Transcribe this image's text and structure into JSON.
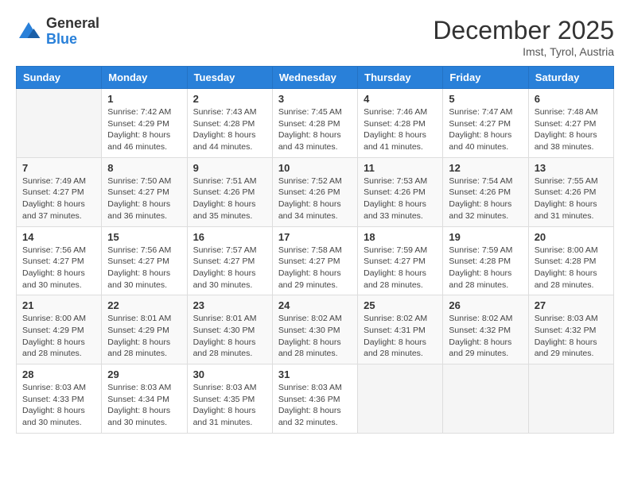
{
  "logo": {
    "general": "General",
    "blue": "Blue"
  },
  "header": {
    "month": "December 2025",
    "location": "Imst, Tyrol, Austria"
  },
  "weekdays": [
    "Sunday",
    "Monday",
    "Tuesday",
    "Wednesday",
    "Thursday",
    "Friday",
    "Saturday"
  ],
  "weeks": [
    [
      {
        "day": "",
        "info": ""
      },
      {
        "day": "1",
        "info": "Sunrise: 7:42 AM\nSunset: 4:29 PM\nDaylight: 8 hours\nand 46 minutes."
      },
      {
        "day": "2",
        "info": "Sunrise: 7:43 AM\nSunset: 4:28 PM\nDaylight: 8 hours\nand 44 minutes."
      },
      {
        "day": "3",
        "info": "Sunrise: 7:45 AM\nSunset: 4:28 PM\nDaylight: 8 hours\nand 43 minutes."
      },
      {
        "day": "4",
        "info": "Sunrise: 7:46 AM\nSunset: 4:28 PM\nDaylight: 8 hours\nand 41 minutes."
      },
      {
        "day": "5",
        "info": "Sunrise: 7:47 AM\nSunset: 4:27 PM\nDaylight: 8 hours\nand 40 minutes."
      },
      {
        "day": "6",
        "info": "Sunrise: 7:48 AM\nSunset: 4:27 PM\nDaylight: 8 hours\nand 38 minutes."
      }
    ],
    [
      {
        "day": "7",
        "info": "Sunrise: 7:49 AM\nSunset: 4:27 PM\nDaylight: 8 hours\nand 37 minutes."
      },
      {
        "day": "8",
        "info": "Sunrise: 7:50 AM\nSunset: 4:27 PM\nDaylight: 8 hours\nand 36 minutes."
      },
      {
        "day": "9",
        "info": "Sunrise: 7:51 AM\nSunset: 4:26 PM\nDaylight: 8 hours\nand 35 minutes."
      },
      {
        "day": "10",
        "info": "Sunrise: 7:52 AM\nSunset: 4:26 PM\nDaylight: 8 hours\nand 34 minutes."
      },
      {
        "day": "11",
        "info": "Sunrise: 7:53 AM\nSunset: 4:26 PM\nDaylight: 8 hours\nand 33 minutes."
      },
      {
        "day": "12",
        "info": "Sunrise: 7:54 AM\nSunset: 4:26 PM\nDaylight: 8 hours\nand 32 minutes."
      },
      {
        "day": "13",
        "info": "Sunrise: 7:55 AM\nSunset: 4:26 PM\nDaylight: 8 hours\nand 31 minutes."
      }
    ],
    [
      {
        "day": "14",
        "info": "Sunrise: 7:56 AM\nSunset: 4:27 PM\nDaylight: 8 hours\nand 30 minutes."
      },
      {
        "day": "15",
        "info": "Sunrise: 7:56 AM\nSunset: 4:27 PM\nDaylight: 8 hours\nand 30 minutes."
      },
      {
        "day": "16",
        "info": "Sunrise: 7:57 AM\nSunset: 4:27 PM\nDaylight: 8 hours\nand 30 minutes."
      },
      {
        "day": "17",
        "info": "Sunrise: 7:58 AM\nSunset: 4:27 PM\nDaylight: 8 hours\nand 29 minutes."
      },
      {
        "day": "18",
        "info": "Sunrise: 7:59 AM\nSunset: 4:27 PM\nDaylight: 8 hours\nand 28 minutes."
      },
      {
        "day": "19",
        "info": "Sunrise: 7:59 AM\nSunset: 4:28 PM\nDaylight: 8 hours\nand 28 minutes."
      },
      {
        "day": "20",
        "info": "Sunrise: 8:00 AM\nSunset: 4:28 PM\nDaylight: 8 hours\nand 28 minutes."
      }
    ],
    [
      {
        "day": "21",
        "info": "Sunrise: 8:00 AM\nSunset: 4:29 PM\nDaylight: 8 hours\nand 28 minutes."
      },
      {
        "day": "22",
        "info": "Sunrise: 8:01 AM\nSunset: 4:29 PM\nDaylight: 8 hours\nand 28 minutes."
      },
      {
        "day": "23",
        "info": "Sunrise: 8:01 AM\nSunset: 4:30 PM\nDaylight: 8 hours\nand 28 minutes."
      },
      {
        "day": "24",
        "info": "Sunrise: 8:02 AM\nSunset: 4:30 PM\nDaylight: 8 hours\nand 28 minutes."
      },
      {
        "day": "25",
        "info": "Sunrise: 8:02 AM\nSunset: 4:31 PM\nDaylight: 8 hours\nand 28 minutes."
      },
      {
        "day": "26",
        "info": "Sunrise: 8:02 AM\nSunset: 4:32 PM\nDaylight: 8 hours\nand 29 minutes."
      },
      {
        "day": "27",
        "info": "Sunrise: 8:03 AM\nSunset: 4:32 PM\nDaylight: 8 hours\nand 29 minutes."
      }
    ],
    [
      {
        "day": "28",
        "info": "Sunrise: 8:03 AM\nSunset: 4:33 PM\nDaylight: 8 hours\nand 30 minutes."
      },
      {
        "day": "29",
        "info": "Sunrise: 8:03 AM\nSunset: 4:34 PM\nDaylight: 8 hours\nand 30 minutes."
      },
      {
        "day": "30",
        "info": "Sunrise: 8:03 AM\nSunset: 4:35 PM\nDaylight: 8 hours\nand 31 minutes."
      },
      {
        "day": "31",
        "info": "Sunrise: 8:03 AM\nSunset: 4:36 PM\nDaylight: 8 hours\nand 32 minutes."
      },
      {
        "day": "",
        "info": ""
      },
      {
        "day": "",
        "info": ""
      },
      {
        "day": "",
        "info": ""
      }
    ]
  ]
}
